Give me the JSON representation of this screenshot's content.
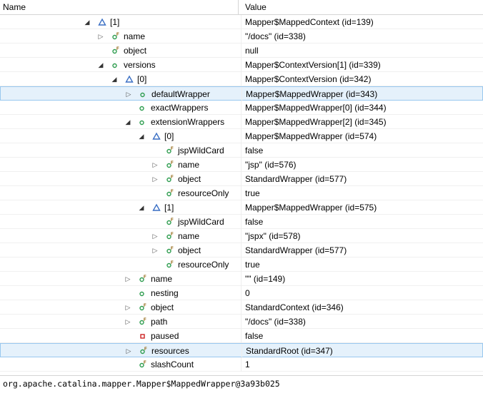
{
  "header": {
    "name_col": "Name",
    "value_col": "Value"
  },
  "rows": [
    {
      "twisty": "expanded",
      "icon": "array-element-icon",
      "label": "[1]",
      "value": "Mapper$MappedContext  (id=139)",
      "depth": 0
    },
    {
      "twisty": "collapsed",
      "icon": "final-field-icon",
      "label": "name",
      "value": "\"/docs\" (id=338)",
      "depth": 1
    },
    {
      "twisty": "none",
      "icon": "final-field-icon",
      "label": "object",
      "value": "null",
      "depth": 1
    },
    {
      "twisty": "expanded",
      "icon": "field-icon",
      "label": "versions",
      "value": "Mapper$ContextVersion[1]  (id=339)",
      "depth": 1
    },
    {
      "twisty": "expanded",
      "icon": "array-element-icon",
      "label": "[0]",
      "value": "Mapper$ContextVersion  (id=342)",
      "depth": 2
    },
    {
      "twisty": "collapsed",
      "icon": "field-icon",
      "label": "defaultWrapper",
      "value": "Mapper$MappedWrapper  (id=343)",
      "depth": 3,
      "selected": true
    },
    {
      "twisty": "none",
      "icon": "field-icon",
      "label": "exactWrappers",
      "value": "Mapper$MappedWrapper[0]  (id=344)",
      "depth": 3
    },
    {
      "twisty": "expanded",
      "icon": "field-icon",
      "label": "extensionWrappers",
      "value": "Mapper$MappedWrapper[2]  (id=345)",
      "depth": 3
    },
    {
      "twisty": "expanded",
      "icon": "array-element-icon",
      "label": "[0]",
      "value": "Mapper$MappedWrapper  (id=574)",
      "depth": 4
    },
    {
      "twisty": "none",
      "icon": "final-field-icon",
      "label": "jspWildCard",
      "value": "false",
      "depth": 5
    },
    {
      "twisty": "collapsed",
      "icon": "final-field-icon",
      "label": "name",
      "value": "\"jsp\" (id=576)",
      "depth": 5
    },
    {
      "twisty": "collapsed",
      "icon": "final-field-icon",
      "label": "object",
      "value": "StandardWrapper  (id=577)",
      "depth": 5
    },
    {
      "twisty": "none",
      "icon": "final-field-icon",
      "label": "resourceOnly",
      "value": "true",
      "depth": 5
    },
    {
      "twisty": "expanded",
      "icon": "array-element-icon",
      "label": "[1]",
      "value": "Mapper$MappedWrapper  (id=575)",
      "depth": 4
    },
    {
      "twisty": "none",
      "icon": "final-field-icon",
      "label": "jspWildCard",
      "value": "false",
      "depth": 5
    },
    {
      "twisty": "collapsed",
      "icon": "final-field-icon",
      "label": "name",
      "value": "\"jspx\" (id=578)",
      "depth": 5
    },
    {
      "twisty": "collapsed",
      "icon": "final-field-icon",
      "label": "object",
      "value": "StandardWrapper  (id=577)",
      "depth": 5
    },
    {
      "twisty": "none",
      "icon": "final-field-icon",
      "label": "resourceOnly",
      "value": "true",
      "depth": 5
    },
    {
      "twisty": "collapsed",
      "icon": "final-field-icon",
      "label": "name",
      "value": "\"\" (id=149)",
      "depth": 3
    },
    {
      "twisty": "none",
      "icon": "field-icon",
      "label": "nesting",
      "value": "0",
      "depth": 3
    },
    {
      "twisty": "collapsed",
      "icon": "final-field-icon",
      "label": "object",
      "value": "StandardContext  (id=346)",
      "depth": 3
    },
    {
      "twisty": "collapsed",
      "icon": "final-field-icon",
      "label": "path",
      "value": "\"/docs\" (id=338)",
      "depth": 3
    },
    {
      "twisty": "none",
      "icon": "private-field-icon",
      "label": "paused",
      "value": "false",
      "depth": 3
    },
    {
      "twisty": "collapsed",
      "icon": "final-field-icon",
      "label": "resources",
      "value": "StandardRoot  (id=347)",
      "depth": 3,
      "selected": true
    },
    {
      "twisty": "none",
      "icon": "final-field-icon",
      "label": "slashCount",
      "value": "1",
      "depth": 3
    }
  ],
  "status": {
    "text": "org.apache.catalina.mapper.Mapper$MappedWrapper@3a93b025"
  },
  "colors": {
    "field_green": "#2e9d4f",
    "array_blue": "#3a6fc4",
    "private_red": "#cc2222",
    "selection": "#e5f1fb"
  }
}
